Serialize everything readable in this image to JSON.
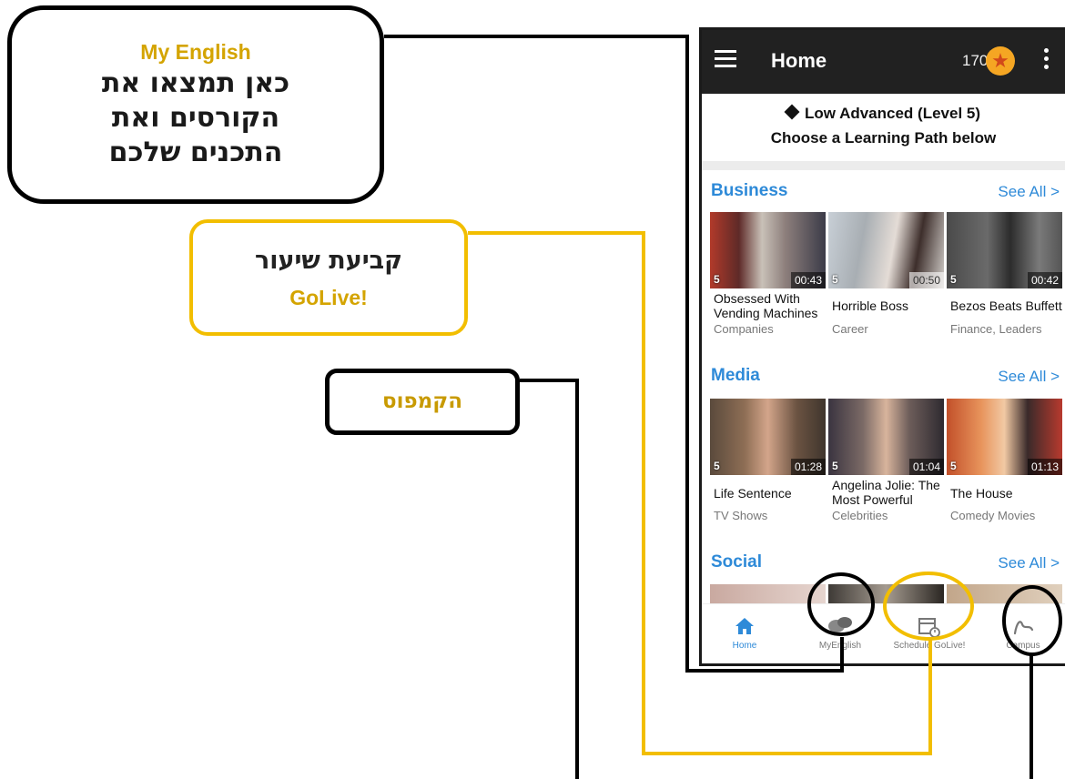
{
  "callouts": {
    "my_english": {
      "title": "My English",
      "text": "כאן תמצאו את הקורסים ואת התכנים שלכם"
    },
    "golive": {
      "text": "קביעת שיעור",
      "title": "GoLive!"
    },
    "campus": {
      "text": "הקמפוס"
    }
  },
  "colors": {
    "accent_gold": "#f2be00",
    "link_blue": "#2e8ad8",
    "appbar": "#212121"
  },
  "app": {
    "title": "Home",
    "coins": "170",
    "level_line": "Low Advanced (Level 5)",
    "subtitle": "Choose a Learning Path below"
  },
  "sections": [
    {
      "title": "Business",
      "see_all": "See All >",
      "items": [
        {
          "name": "Obsessed With Vending Machines",
          "category": "Companies",
          "level": "5",
          "duration": "00:43"
        },
        {
          "name": "Horrible Boss",
          "category": "Career",
          "level": "5",
          "duration": "00:50"
        },
        {
          "name": "Bezos Beats Buffett",
          "category": "Finance, Leaders",
          "level": "5",
          "duration": "00:42"
        }
      ]
    },
    {
      "title": "Media",
      "see_all": "See All >",
      "items": [
        {
          "name": "Life Sentence",
          "category": "TV Shows",
          "level": "5",
          "duration": "01:28"
        },
        {
          "name": "Angelina Jolie: The Most Powerful",
          "category": "Celebrities",
          "level": "5",
          "duration": "01:04"
        },
        {
          "name": "The House",
          "category": "Comedy Movies",
          "level": "5",
          "duration": "01:13"
        }
      ]
    },
    {
      "title": "Social",
      "see_all": "See All >"
    }
  ],
  "bottom_nav": [
    {
      "label": "Home",
      "icon": "home-icon"
    },
    {
      "label": "MyEnglish",
      "icon": "chat-bubbles-icon"
    },
    {
      "label": "Schedule GoLive!",
      "icon": "calendar-clock-icon"
    },
    {
      "label": "Campus",
      "icon": "campus-swoosh-icon"
    }
  ]
}
